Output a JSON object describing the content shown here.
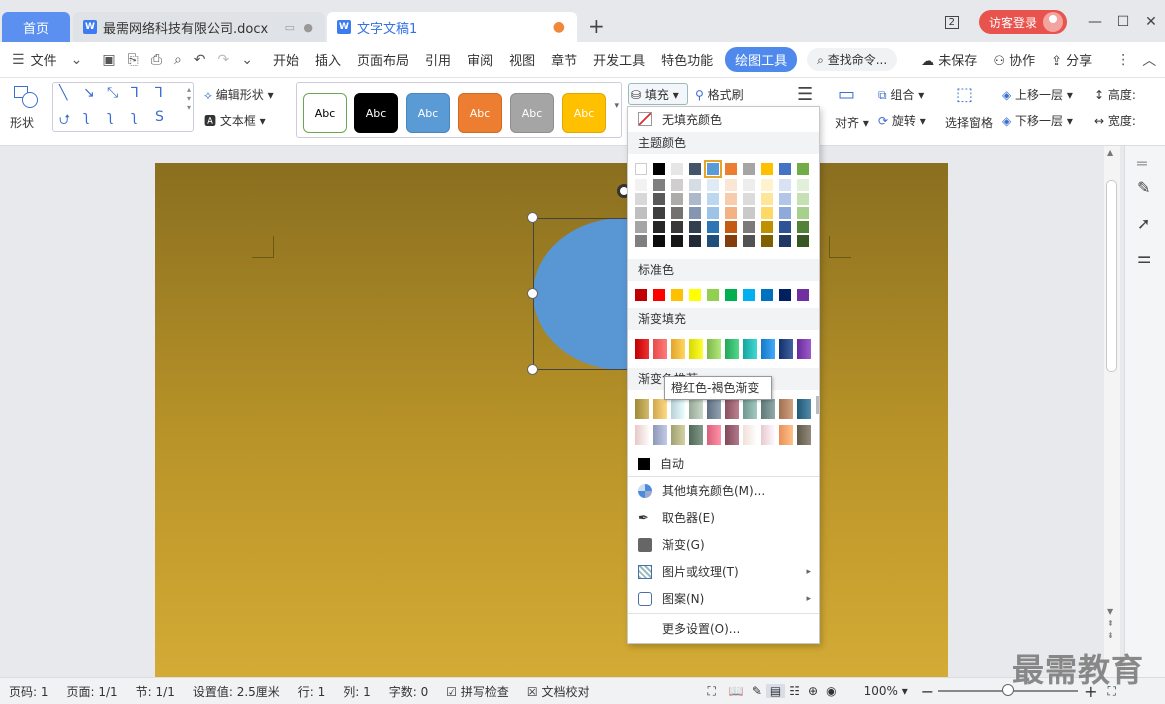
{
  "tabs": {
    "home": "首页",
    "doc1": "最需网络科技有限公司.docx",
    "doc2": "文字文稿1",
    "new_tab": "+"
  },
  "titlebar": {
    "badge": "2",
    "login": "访客登录"
  },
  "menubar": {
    "file": "文件",
    "items": [
      "开始",
      "插入",
      "页面布局",
      "引用",
      "审阅",
      "视图",
      "章节",
      "开发工具",
      "特色功能"
    ],
    "active": "绘图工具",
    "search": "查找命令...",
    "unsaved": "未保存",
    "collab": "协作",
    "share": "分享"
  },
  "ribbon": {
    "shape": "形状",
    "edit_shape": "编辑形状",
    "textbox": "文本框",
    "style_label": "Abc",
    "styles": [
      {
        "bg": "#ffffff",
        "fg": "#000000",
        "border": "#6aa84f"
      },
      {
        "bg": "#000000",
        "fg": "#ffffff",
        "border": "#000000"
      },
      {
        "bg": "#5b9bd5",
        "fg": "#ffffff",
        "border": "#4a86c0"
      },
      {
        "bg": "#ed7d31",
        "fg": "#ffffff",
        "border": "#d06a24"
      },
      {
        "bg": "#a5a5a5",
        "fg": "#ffffff",
        "border": "#8e8e8e"
      },
      {
        "bg": "#ffc000",
        "fg": "#ffffff",
        "border": "#e0a800"
      }
    ],
    "fill": "填充",
    "format_painter": "格式刷",
    "align": "对齐",
    "group": "组合",
    "rotate": "旋转",
    "select_pane": "选择窗格",
    "bring_forward": "上移一层",
    "send_backward": "下移一层",
    "height": "高度:",
    "width": "宽度:"
  },
  "fill_dropdown": {
    "no_fill": "无填充颜色",
    "theme_colors": "主题颜色",
    "standard_colors": "标准色",
    "gradient_fill": "渐变填充",
    "gradient_presets": "渐变色推荐",
    "auto": "自动",
    "more_colors": "其他填充颜色(M)...",
    "eyedropper": "取色器(E)",
    "gradient": "渐变(G)",
    "picture_texture": "图片或纹理(T)",
    "pattern": "图案(N)",
    "more_settings": "更多设置(O)...",
    "theme_top": [
      "#ffffff",
      "#000000",
      "#e7e6e6",
      "#44546a",
      "#5b9bd5",
      "#ed7d31",
      "#a5a5a5",
      "#ffc000",
      "#4472c4",
      "#70ad47"
    ],
    "theme_shades": [
      [
        "#f2f2f2",
        "#7f7f7f",
        "#d0cece",
        "#d6dce4",
        "#deebf6",
        "#fbe5d5",
        "#ededed",
        "#fff2cc",
        "#d9e2f3",
        "#e2efd9"
      ],
      [
        "#d8d8d8",
        "#595959",
        "#aeabab",
        "#adb9ca",
        "#bdd7ee",
        "#f7cbac",
        "#dbdbdb",
        "#fee599",
        "#b4c6e7",
        "#c5e0b3"
      ],
      [
        "#bfbfbf",
        "#3f3f3f",
        "#757171",
        "#8496b0",
        "#9dc3e6",
        "#f4b183",
        "#c9c9c9",
        "#ffd965",
        "#8eaadb",
        "#a8d08d"
      ],
      [
        "#a5a5a5",
        "#262626",
        "#3a3838",
        "#323f4f",
        "#2e75b5",
        "#c55a11",
        "#7b7b7b",
        "#bf9000",
        "#2f5496",
        "#538135"
      ],
      [
        "#7f7f7f",
        "#0c0c0c",
        "#171616",
        "#222a35",
        "#1e4e79",
        "#833c0b",
        "#525252",
        "#7f6000",
        "#1f3864",
        "#375623"
      ]
    ],
    "standard": [
      "#c00000",
      "#ff0000",
      "#ffc000",
      "#ffff00",
      "#92d050",
      "#00b050",
      "#00b0f0",
      "#0070c0",
      "#002060",
      "#7030a0"
    ],
    "gradients": [
      "#c00000",
      "#e84a4a",
      "#e3a42a",
      "#d8d800",
      "#7fb84a",
      "#22a65a",
      "#12a6a0",
      "#1478c8",
      "#10306e",
      "#6a2a9a"
    ],
    "presets_row1": [
      "#a08a3a",
      "#d0a850",
      "#b8d0d8",
      "#98a898",
      "#607080",
      "#8a5060",
      "#709890",
      "#607878",
      "#a07050",
      "#205878"
    ],
    "presets_row2": [
      "#e8c8c8",
      "#9098b8",
      "#a0a070",
      "#506858",
      "#d86078",
      "#804858",
      "#f0e0d8",
      "#e8c8d0",
      "#e89058",
      "#605848"
    ],
    "tooltip": "橙红色-褐色渐变"
  },
  "statusbar": {
    "page_num": "页码: 1",
    "pages": "页面: 1/1",
    "section": "节: 1/1",
    "setting": "设置值: 2.5厘米",
    "row": "行: 1",
    "col": "列: 1",
    "words": "字数: 0",
    "spell": "拼写检查",
    "proof": "文档校对",
    "zoom": "100%",
    "zoom_level": 0.5
  },
  "watermark": "最需教育"
}
